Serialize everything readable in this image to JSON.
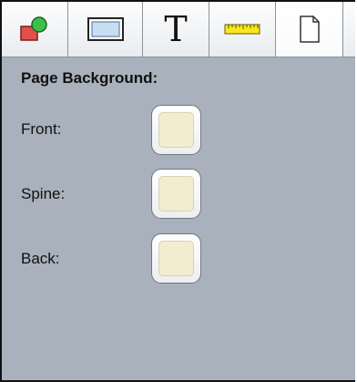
{
  "toolbar": {
    "tools": [
      {
        "name": "shapes",
        "icon": "shapes-icon",
        "selected": false
      },
      {
        "name": "border",
        "icon": "rectangle-icon",
        "selected": false
      },
      {
        "name": "text",
        "icon": "text-icon",
        "glyph": "T",
        "selected": false
      },
      {
        "name": "ruler",
        "icon": "ruler-icon",
        "selected": false
      },
      {
        "name": "page",
        "icon": "page-icon",
        "selected": true
      }
    ]
  },
  "panel": {
    "heading": "Page Background:",
    "rows": [
      {
        "label": "Front:",
        "color": "#f3edd0"
      },
      {
        "label": "Spine:",
        "color": "#f3edd0"
      },
      {
        "label": "Back:",
        "color": "#f3edd0"
      }
    ]
  },
  "colors": {
    "panel_background": "#a8b1bc",
    "swatch_color": "#f3edd0",
    "shape_red": "#e2504b",
    "shape_green": "#3cc04a",
    "ruler_yellow": "#f7e81e"
  }
}
